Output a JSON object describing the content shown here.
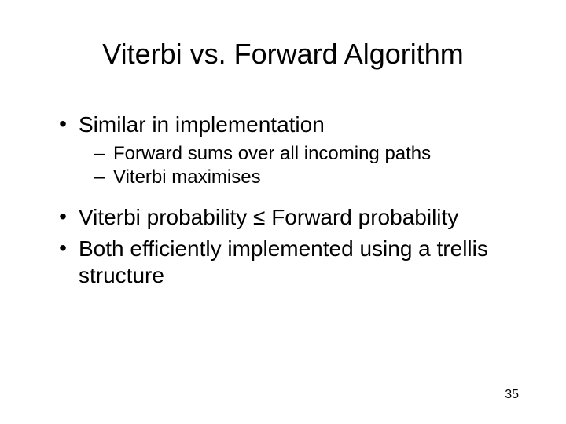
{
  "title": "Viterbi vs. Forward Algorithm",
  "bullets": [
    {
      "text": "Similar in implementation",
      "sub": [
        "Forward sums over all incoming paths",
        "Viterbi maximises"
      ]
    },
    {
      "text": "Viterbi probability ≤ Forward probability",
      "sub": []
    },
    {
      "text": "Both efficiently implemented using a trellis structure",
      "sub": []
    }
  ],
  "page_number": "35"
}
